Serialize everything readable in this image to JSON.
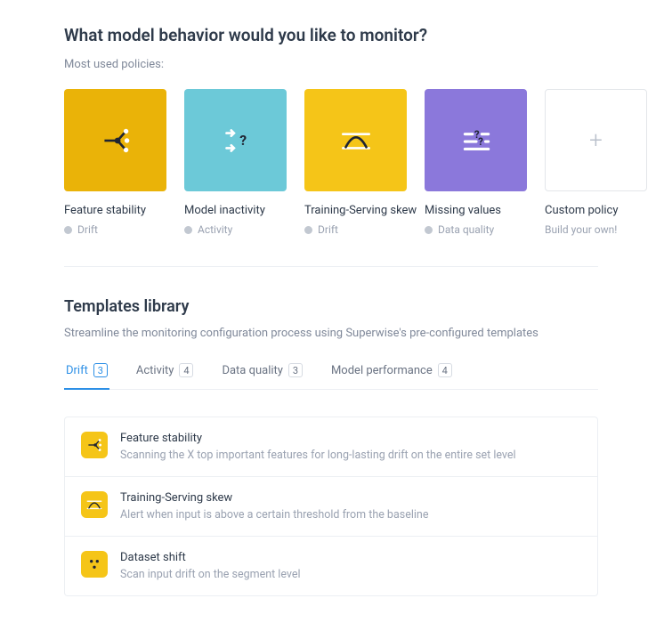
{
  "header": {
    "title": "What model behavior would you like to monitor?",
    "subtitle": "Most used policies:"
  },
  "policies": [
    {
      "title": "Feature stability",
      "tag": "Drift",
      "tile_color": "#eab308",
      "icon": "branch"
    },
    {
      "title": "Model inactivity",
      "tag": "Activity",
      "tile_color": "#6cc9d8",
      "icon": "split-question"
    },
    {
      "title": "Training-Serving skew",
      "tag": "Drift",
      "tile_color": "#f5c518",
      "icon": "curve"
    },
    {
      "title": "Missing values",
      "tag": "Data quality",
      "tile_color": "#8b78db",
      "icon": "blanks"
    },
    {
      "title": "Custom policy",
      "tag": "Build your own!",
      "tile_color": "#ffffff",
      "icon": "plus",
      "custom": true
    }
  ],
  "library": {
    "title": "Templates library",
    "description": "Streamline the monitoring configuration process using Superwise's pre-configured templates"
  },
  "tabs": [
    {
      "label": "Drift",
      "count": 3,
      "active": true
    },
    {
      "label": "Activity",
      "count": 4,
      "active": false
    },
    {
      "label": "Data quality",
      "count": 3,
      "active": false
    },
    {
      "label": "Model performance",
      "count": 4,
      "active": false
    }
  ],
  "templates": [
    {
      "title": "Feature stability",
      "description": "Scanning the X top important features for long-lasting drift on the entire set level",
      "icon": "branch"
    },
    {
      "title": "Training-Serving skew",
      "description": "Alert when input is above a certain threshold from the baseline",
      "icon": "curve"
    },
    {
      "title": "Dataset shift",
      "description": "Scan input drift on the segment level",
      "icon": "dots"
    }
  ]
}
